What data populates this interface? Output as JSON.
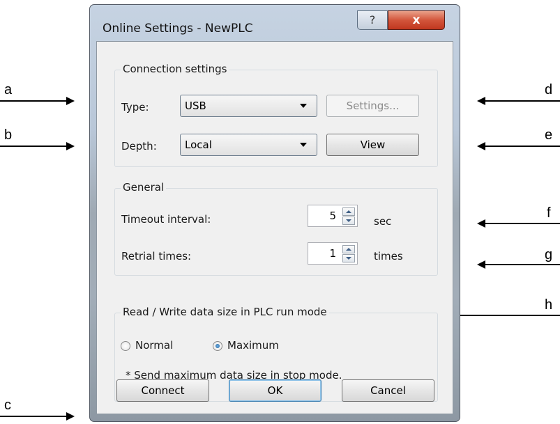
{
  "annotations": {
    "a": "a",
    "b": "b",
    "c": "c",
    "d": "d",
    "e": "e",
    "f": "f",
    "g": "g",
    "h": "h"
  },
  "window": {
    "title": "Online Settings - NewPLC",
    "help_glyph": "?",
    "close_glyph": "x"
  },
  "connection": {
    "group_title": "Connection settings",
    "type_label": "Type:",
    "type_value": "USB",
    "settings_button": "Settings...",
    "depth_label": "Depth:",
    "depth_value": "Local",
    "view_button": "View"
  },
  "general": {
    "group_title": "General",
    "timeout_label": "Timeout interval:",
    "timeout_value": "5",
    "timeout_unit": "sec",
    "retrial_label": "Retrial times:",
    "retrial_value": "1",
    "retrial_unit": "times"
  },
  "datasize": {
    "group_title": "Read / Write data size in PLC run mode",
    "normal_label": "Normal",
    "maximum_label": "Maximum",
    "selected": "Maximum",
    "note": "* Send maximum data size in stop mode."
  },
  "footer": {
    "connect_button": "Connect",
    "ok_button": "OK",
    "cancel_button": "Cancel"
  }
}
